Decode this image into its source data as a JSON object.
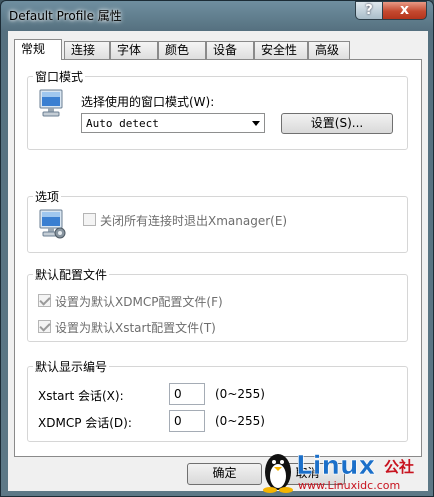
{
  "window": {
    "title": "Default Profile 属性",
    "help_glyph": "?",
    "close_glyph": "x"
  },
  "tabs": [
    {
      "label": "常规",
      "active": true
    },
    {
      "label": "连接"
    },
    {
      "label": "字体"
    },
    {
      "label": "颜色"
    },
    {
      "label": "设备"
    },
    {
      "label": "安全性"
    },
    {
      "label": "高级"
    }
  ],
  "window_mode": {
    "title": "窗口模式",
    "prompt": "选择使用的窗口模式(W):",
    "selected": "Auto detect",
    "settings_button": "设置(S)..."
  },
  "options": {
    "title": "选项",
    "close_on_exit": "关闭所有连接时退出Xmanager(E)",
    "close_on_exit_checked": false
  },
  "default_config": {
    "title": "默认配置文件",
    "xdmcp_default": "设置为默认XDMCP配置文件(F)",
    "xdmcp_checked": true,
    "xstart_default": "设置为默认Xstart配置文件(T)",
    "xstart_checked": true
  },
  "default_display": {
    "title": "默认显示编号",
    "xstart_label": "Xstart 会话(X):",
    "xstart_value": "0",
    "xstart_range": "(0~255)",
    "xdmcp_label": "XDMCP 会话(D):",
    "xdmcp_value": "0",
    "xdmcp_range": "(0~255)"
  },
  "footer": {
    "ok": "确定",
    "cancel": "取消"
  },
  "watermark": {
    "brand": "Linux",
    "suffix": "公社",
    "site": "www.Linuxidc.com"
  },
  "colors": {
    "accent": "#1b6fc9",
    "titlebar": "#5d7886"
  }
}
